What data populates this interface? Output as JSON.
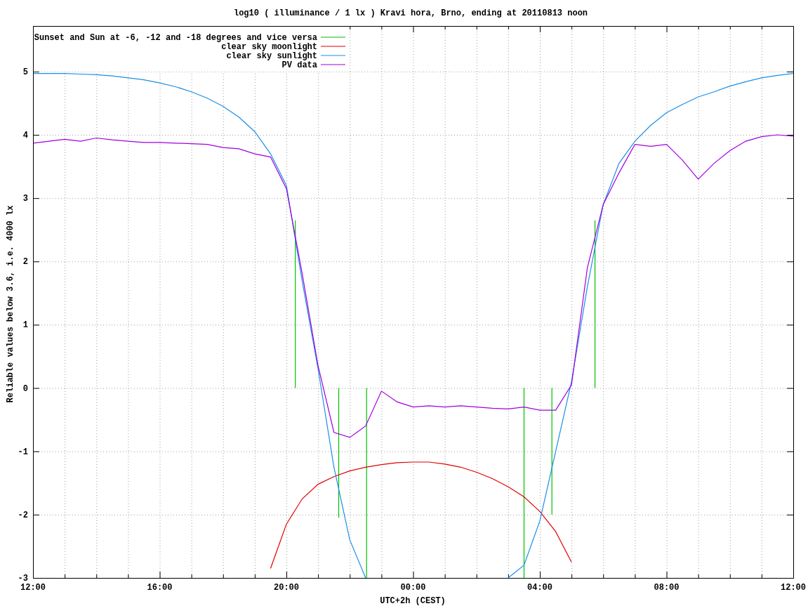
{
  "chart_data": {
    "type": "line",
    "title": "log10 ( illuminance / 1 lx ) Kravi hora, Brno, ending at 20110813 noon",
    "xlabel": "UTC+2h (CEST)",
    "ylabel": "Reliable values below 3.6, i.e. 4000 lx",
    "categories": [
      "12:00",
      null,
      null,
      null,
      null,
      null,
      null,
      null,
      "16:00",
      null,
      null,
      null,
      null,
      null,
      null,
      null,
      "20:00",
      null,
      null,
      null,
      null,
      null,
      null,
      null,
      "00:00",
      null,
      null,
      null,
      null,
      null,
      null,
      null,
      "04:00",
      null,
      null,
      null,
      null,
      null,
      null,
      null,
      "08:00",
      null,
      null,
      null,
      null,
      null,
      null,
      null,
      "12:00"
    ],
    "ylim": [
      -3,
      5.72
    ],
    "yticks": [
      -3,
      -2,
      -1,
      0,
      1,
      2,
      3,
      4,
      5
    ],
    "series": [
      {
        "name": "Sunset and Sun at -6, -12 and -18 degrees and vice versa",
        "color": "#00c000",
        "values": [
          null,
          null,
          null,
          null,
          null,
          null,
          null,
          null,
          null,
          null,
          null,
          null,
          null,
          null,
          null,
          null,
          null,
          null,
          null,
          null,
          null,
          null,
          null,
          null,
          null,
          null,
          null,
          null,
          null,
          null,
          null,
          null,
          null,
          null,
          null,
          null,
          null,
          null,
          null,
          null,
          null,
          null,
          null,
          null,
          null,
          null,
          null,
          null,
          null
        ]
      },
      {
        "name": "clear sky moonlight",
        "color": "#e00000",
        "values": [
          null,
          null,
          null,
          null,
          null,
          null,
          null,
          null,
          null,
          null,
          null,
          null,
          null,
          null,
          null,
          -2.85,
          -2.15,
          -1.75,
          -1.52,
          -1.4,
          -1.31,
          -1.25,
          -1.21,
          -1.18,
          -1.17,
          -1.17,
          -1.2,
          -1.25,
          -1.33,
          -1.43,
          -1.56,
          -1.72,
          -1.95,
          -2.27,
          -2.75,
          null,
          null,
          null,
          null,
          null,
          null,
          null,
          null,
          null,
          null,
          null,
          null,
          null,
          null
        ]
      },
      {
        "name": "clear sky sunlight",
        "color": "#1a8fe8",
        "values": [
          4.97,
          4.97,
          4.97,
          4.96,
          4.95,
          4.93,
          4.9,
          4.87,
          4.82,
          4.76,
          4.68,
          4.58,
          4.45,
          4.28,
          4.05,
          3.7,
          3.2,
          1.68,
          0.3,
          -1.25,
          -2.4,
          -3.0,
          null,
          null,
          null,
          null,
          null,
          null,
          null,
          null,
          -3.0,
          -2.8,
          -2.1,
          -1.0,
          0.1,
          1.6,
          2.9,
          3.55,
          3.9,
          4.15,
          4.35,
          4.48,
          4.6,
          4.68,
          4.77,
          4.84,
          4.9,
          4.94,
          4.97
        ]
      },
      {
        "name": "PV data",
        "color": "#a000e0",
        "values": [
          3.87,
          3.9,
          3.93,
          3.9,
          3.95,
          3.92,
          3.9,
          3.88,
          3.88,
          3.87,
          3.86,
          3.85,
          3.8,
          3.78,
          3.7,
          3.65,
          3.15,
          1.8,
          0.35,
          -0.7,
          -0.78,
          -0.6,
          -0.05,
          -0.22,
          -0.3,
          -0.28,
          -0.3,
          -0.28,
          -0.3,
          -0.32,
          -0.33,
          -0.3,
          -0.35,
          -0.35,
          0.05,
          1.9,
          2.9,
          3.4,
          3.85,
          3.82,
          3.85,
          3.6,
          3.3,
          3.55,
          3.75,
          3.9,
          3.97,
          4.0,
          3.98
        ]
      }
    ],
    "grid": true,
    "legend": true
  }
}
